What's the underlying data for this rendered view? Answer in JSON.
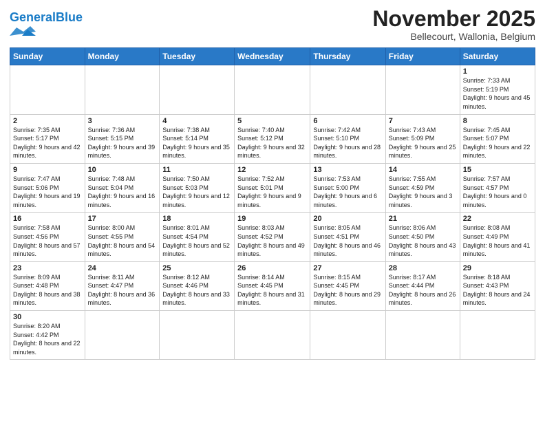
{
  "header": {
    "logo_general": "General",
    "logo_blue": "Blue",
    "month_title": "November 2025",
    "subtitle": "Bellecourt, Wallonia, Belgium"
  },
  "days_of_week": [
    "Sunday",
    "Monday",
    "Tuesday",
    "Wednesday",
    "Thursday",
    "Friday",
    "Saturday"
  ],
  "weeks": [
    [
      {
        "day": "",
        "info": ""
      },
      {
        "day": "",
        "info": ""
      },
      {
        "day": "",
        "info": ""
      },
      {
        "day": "",
        "info": ""
      },
      {
        "day": "",
        "info": ""
      },
      {
        "day": "",
        "info": ""
      },
      {
        "day": "1",
        "info": "Sunrise: 7:33 AM\nSunset: 5:19 PM\nDaylight: 9 hours and 45 minutes."
      }
    ],
    [
      {
        "day": "2",
        "info": "Sunrise: 7:35 AM\nSunset: 5:17 PM\nDaylight: 9 hours and 42 minutes."
      },
      {
        "day": "3",
        "info": "Sunrise: 7:36 AM\nSunset: 5:15 PM\nDaylight: 9 hours and 39 minutes."
      },
      {
        "day": "4",
        "info": "Sunrise: 7:38 AM\nSunset: 5:14 PM\nDaylight: 9 hours and 35 minutes."
      },
      {
        "day": "5",
        "info": "Sunrise: 7:40 AM\nSunset: 5:12 PM\nDaylight: 9 hours and 32 minutes."
      },
      {
        "day": "6",
        "info": "Sunrise: 7:42 AM\nSunset: 5:10 PM\nDaylight: 9 hours and 28 minutes."
      },
      {
        "day": "7",
        "info": "Sunrise: 7:43 AM\nSunset: 5:09 PM\nDaylight: 9 hours and 25 minutes."
      },
      {
        "day": "8",
        "info": "Sunrise: 7:45 AM\nSunset: 5:07 PM\nDaylight: 9 hours and 22 minutes."
      }
    ],
    [
      {
        "day": "9",
        "info": "Sunrise: 7:47 AM\nSunset: 5:06 PM\nDaylight: 9 hours and 19 minutes."
      },
      {
        "day": "10",
        "info": "Sunrise: 7:48 AM\nSunset: 5:04 PM\nDaylight: 9 hours and 16 minutes."
      },
      {
        "day": "11",
        "info": "Sunrise: 7:50 AM\nSunset: 5:03 PM\nDaylight: 9 hours and 12 minutes."
      },
      {
        "day": "12",
        "info": "Sunrise: 7:52 AM\nSunset: 5:01 PM\nDaylight: 9 hours and 9 minutes."
      },
      {
        "day": "13",
        "info": "Sunrise: 7:53 AM\nSunset: 5:00 PM\nDaylight: 9 hours and 6 minutes."
      },
      {
        "day": "14",
        "info": "Sunrise: 7:55 AM\nSunset: 4:59 PM\nDaylight: 9 hours and 3 minutes."
      },
      {
        "day": "15",
        "info": "Sunrise: 7:57 AM\nSunset: 4:57 PM\nDaylight: 9 hours and 0 minutes."
      }
    ],
    [
      {
        "day": "16",
        "info": "Sunrise: 7:58 AM\nSunset: 4:56 PM\nDaylight: 8 hours and 57 minutes."
      },
      {
        "day": "17",
        "info": "Sunrise: 8:00 AM\nSunset: 4:55 PM\nDaylight: 8 hours and 54 minutes."
      },
      {
        "day": "18",
        "info": "Sunrise: 8:01 AM\nSunset: 4:54 PM\nDaylight: 8 hours and 52 minutes."
      },
      {
        "day": "19",
        "info": "Sunrise: 8:03 AM\nSunset: 4:52 PM\nDaylight: 8 hours and 49 minutes."
      },
      {
        "day": "20",
        "info": "Sunrise: 8:05 AM\nSunset: 4:51 PM\nDaylight: 8 hours and 46 minutes."
      },
      {
        "day": "21",
        "info": "Sunrise: 8:06 AM\nSunset: 4:50 PM\nDaylight: 8 hours and 43 minutes."
      },
      {
        "day": "22",
        "info": "Sunrise: 8:08 AM\nSunset: 4:49 PM\nDaylight: 8 hours and 41 minutes."
      }
    ],
    [
      {
        "day": "23",
        "info": "Sunrise: 8:09 AM\nSunset: 4:48 PM\nDaylight: 8 hours and 38 minutes."
      },
      {
        "day": "24",
        "info": "Sunrise: 8:11 AM\nSunset: 4:47 PM\nDaylight: 8 hours and 36 minutes."
      },
      {
        "day": "25",
        "info": "Sunrise: 8:12 AM\nSunset: 4:46 PM\nDaylight: 8 hours and 33 minutes."
      },
      {
        "day": "26",
        "info": "Sunrise: 8:14 AM\nSunset: 4:45 PM\nDaylight: 8 hours and 31 minutes."
      },
      {
        "day": "27",
        "info": "Sunrise: 8:15 AM\nSunset: 4:45 PM\nDaylight: 8 hours and 29 minutes."
      },
      {
        "day": "28",
        "info": "Sunrise: 8:17 AM\nSunset: 4:44 PM\nDaylight: 8 hours and 26 minutes."
      },
      {
        "day": "29",
        "info": "Sunrise: 8:18 AM\nSunset: 4:43 PM\nDaylight: 8 hours and 24 minutes."
      }
    ],
    [
      {
        "day": "30",
        "info": "Sunrise: 8:20 AM\nSunset: 4:42 PM\nDaylight: 8 hours and 22 minutes."
      },
      {
        "day": "",
        "info": ""
      },
      {
        "day": "",
        "info": ""
      },
      {
        "day": "",
        "info": ""
      },
      {
        "day": "",
        "info": ""
      },
      {
        "day": "",
        "info": ""
      },
      {
        "day": "",
        "info": ""
      }
    ]
  ]
}
